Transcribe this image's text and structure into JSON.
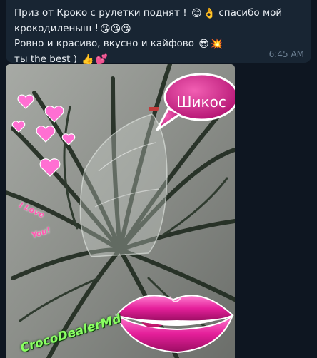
{
  "message": {
    "lines": [
      "Приз от Кроко  с рулетки  поднят  ! ",
      "крокодиленыш !",
      "Ровно и красиво, вкусно и кайфово ",
      "ты the best ) "
    ],
    "line1_tail": "  спасибо  мой",
    "time": "6:45 AM",
    "emojis": {
      "smile": "😊",
      "ok": "👌",
      "kiss": "😘😘😘",
      "cool": "😎",
      "boom": "💥",
      "thumbs": "👍",
      "hearts": "💕"
    }
  },
  "photo": {
    "speech_bubble": "Шикос",
    "love_top": "I Love",
    "love_bottom": "You!",
    "watermark": "CrocoDealerMd"
  },
  "colors": {
    "background": "#0e1621",
    "bubble": "#182533",
    "text": "#e9eef3",
    "time": "#6c7f92",
    "sticker_pink": "#d82f8e",
    "watermark_green": "#8aff62"
  }
}
